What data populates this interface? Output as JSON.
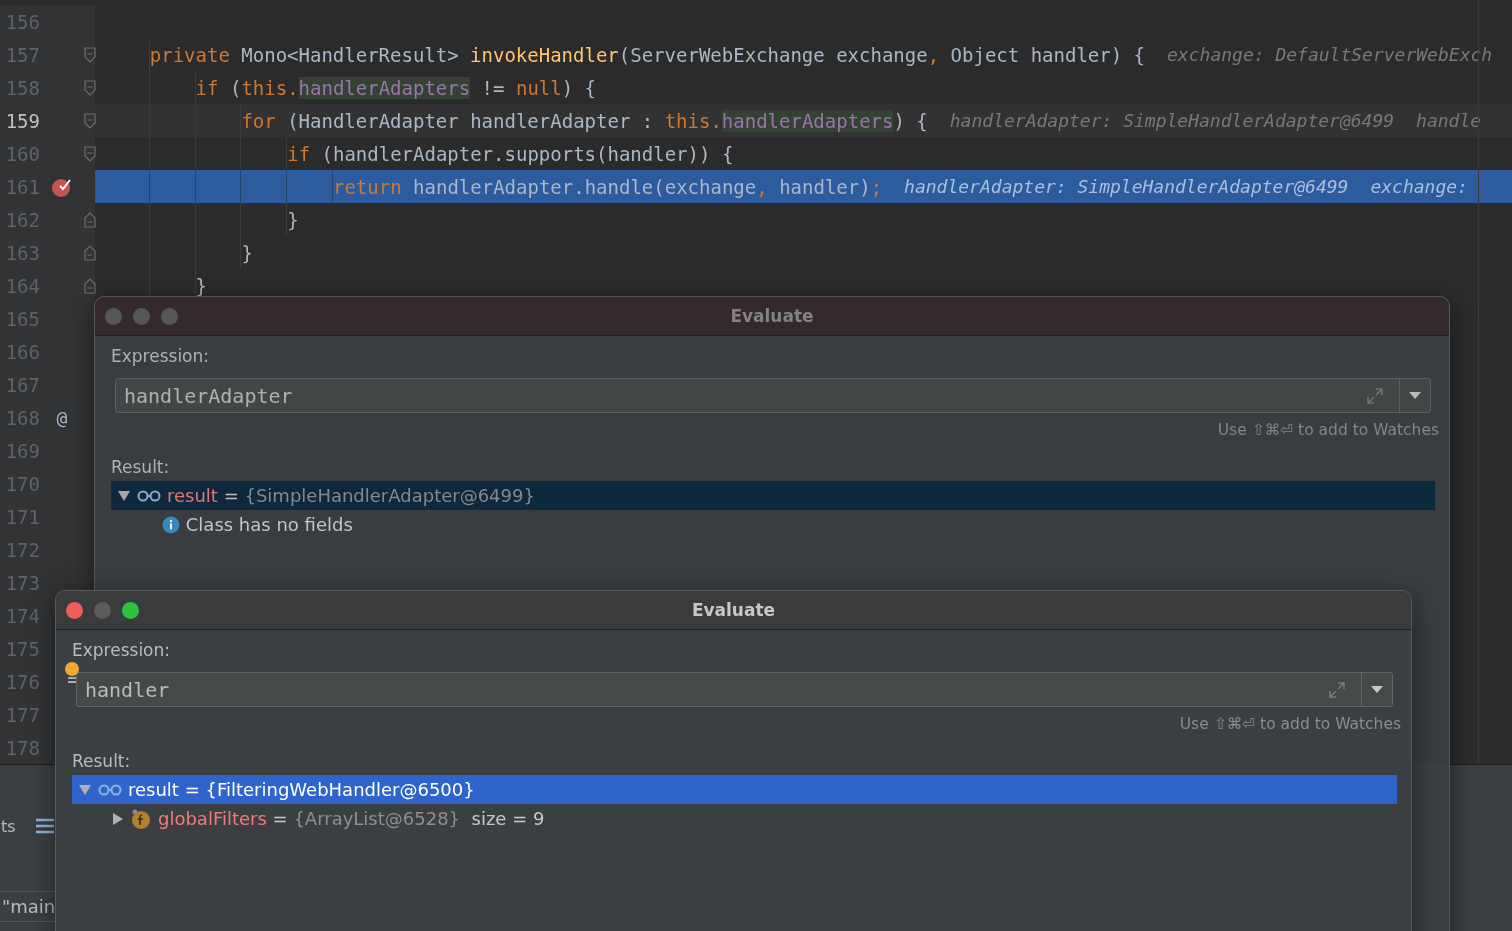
{
  "editor": {
    "lines": [
      {
        "number": "156"
      },
      {
        "number": "157",
        "fold_start": true,
        "tokens": [
          {
            "kind": "keyword",
            "text": "private "
          },
          {
            "kind": "plain",
            "text": "Mono<HandlerResult> "
          },
          {
            "kind": "method",
            "text": "invokeHandler"
          },
          {
            "kind": "plain",
            "text": "(ServerWebExchange exchange"
          },
          {
            "kind": "punct",
            "text": ", "
          },
          {
            "kind": "plain",
            "text": "Object handler) {"
          }
        ],
        "hints": [
          "exchange: DefaultServerWebExch"
        ],
        "children": [
          {
            "number": "158",
            "fold_start": true,
            "tokens": [
              {
                "kind": "keyword",
                "text": "if "
              },
              {
                "kind": "plain",
                "text": "("
              },
              {
                "kind": "keyword",
                "text": "this."
              },
              {
                "kind": "field",
                "text": "handlerAdapters"
              },
              {
                "kind": "plain",
                "text": " != "
              },
              {
                "kind": "keyword",
                "text": "null"
              },
              {
                "kind": "plain",
                "text": ") {"
              }
            ],
            "children": [
              {
                "number": "159",
                "fold_start": true,
                "caret": true,
                "tokens": [
                  {
                    "kind": "keyword",
                    "text": "for "
                  },
                  {
                    "kind": "plain",
                    "text": "(HandlerAdapter handlerAdapter : "
                  },
                  {
                    "kind": "keyword",
                    "text": "this."
                  },
                  {
                    "kind": "field",
                    "text": "handlerAdapters"
                  },
                  {
                    "kind": "plain",
                    "text": ") {"
                  }
                ],
                "hints": [
                  "handlerAdapter: SimpleHandlerAdapter@6499",
                  "handle"
                ],
                "children": [
                  {
                    "number": "160",
                    "fold_start": true,
                    "tokens": [
                      {
                        "kind": "keyword",
                        "text": "if "
                      },
                      {
                        "kind": "plain",
                        "text": "(handlerAdapter.supports(handler)) {"
                      }
                    ],
                    "children": [
                      {
                        "number": "161",
                        "current": true,
                        "breakpoint": true,
                        "tokens": [
                          {
                            "kind": "keyword",
                            "text": "return "
                          },
                          {
                            "kind": "plain",
                            "text": "handlerAdapter.handle(exchange"
                          },
                          {
                            "kind": "punct",
                            "text": ", "
                          },
                          {
                            "kind": "plain",
                            "text": "handler)"
                          },
                          {
                            "kind": "punct",
                            "text": ";"
                          }
                        ],
                        "hints": [
                          "handlerAdapter: SimpleHandlerAdapter@6499",
                          "exchange:"
                        ]
                      }
                    ]
                  },
                  {
                    "number": "162",
                    "fold_end": true,
                    "tokens": [
                      {
                        "kind": "plain",
                        "text": "}"
                      }
                    ]
                  }
                ]
              },
              {
                "number": "163",
                "fold_end": true,
                "tokens": [
                  {
                    "kind": "plain",
                    "text": "}"
                  }
                ]
              }
            ]
          },
          {
            "number": "164",
            "fold_end": true,
            "tokens": [
              {
                "kind": "plain",
                "text": "}"
              }
            ]
          }
        ]
      },
      {
        "number": "165"
      },
      {
        "number": "166"
      },
      {
        "number": "167"
      },
      {
        "number": "168",
        "gutter_text": "@"
      },
      {
        "number": "169"
      },
      {
        "number": "170"
      },
      {
        "number": "171"
      },
      {
        "number": "172"
      },
      {
        "number": "173"
      },
      {
        "number": "174"
      },
      {
        "number": "175"
      },
      {
        "number": "176"
      },
      {
        "number": "177"
      },
      {
        "number": "178"
      }
    ]
  },
  "bottom_panel": {
    "tab_label": "ts",
    "thread": "\"main"
  },
  "dialogs": [
    {
      "title": "Evaluate",
      "active": false,
      "expression_label": "Expression:",
      "expression": "handlerAdapter",
      "watch_hint": "Use ⇧⌘⏎ to add to Watches",
      "result_label": "Result:",
      "tree": [
        {
          "kind": "watch",
          "name": "result",
          "operator": "=",
          "value": "{SimpleHandlerAdapter@6499}",
          "expanded": true,
          "selected": true,
          "children": [
            {
              "kind": "info",
              "text": "Class has no fields"
            }
          ]
        }
      ]
    },
    {
      "title": "Evaluate",
      "active": true,
      "expression_label": "Expression:",
      "expression": "handler",
      "intention_bulb": true,
      "watch_hint": "Use ⇧⌘⏎ to add to Watches",
      "result_label": "Result:",
      "tree": [
        {
          "kind": "watch",
          "name": "result",
          "operator": "=",
          "value": "{FilteringWebHandler@6500}",
          "expanded": true,
          "selected": true,
          "children": [
            {
              "kind": "field",
              "name": "globalFilters",
              "operator": "=",
              "value": "{ArrayList@6528}",
              "extra": "size = 9",
              "expanded": false,
              "selected": false
            }
          ]
        }
      ]
    }
  ]
}
